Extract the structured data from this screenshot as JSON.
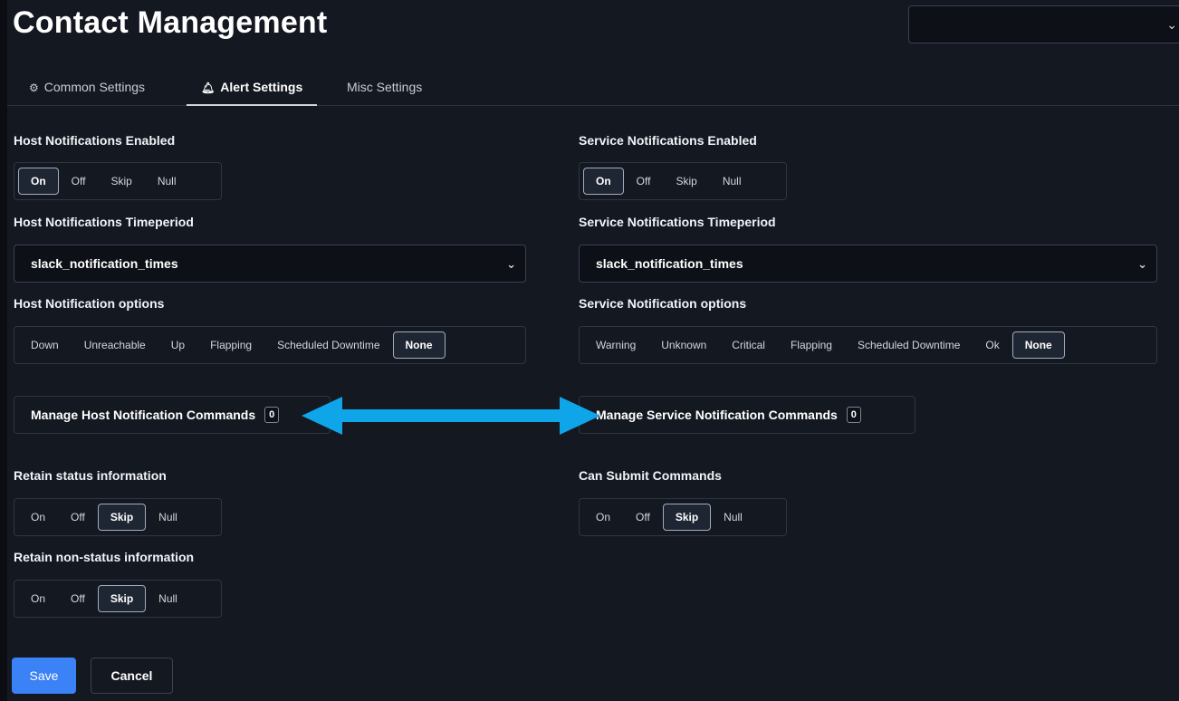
{
  "page": {
    "title": "Contact Management",
    "top_select_value": ""
  },
  "tabs": [
    {
      "label": "Common Settings",
      "icon": "gear-icon"
    },
    {
      "label": "Alert Settings",
      "icon": "bell-icon"
    },
    {
      "label": "Misc Settings",
      "icon": ""
    }
  ],
  "active_tab": "Alert Settings",
  "host_notifications_enabled": {
    "label": "Host Notifications Enabled",
    "options": [
      "On",
      "Off",
      "Skip",
      "Null"
    ],
    "selected": "On"
  },
  "service_notifications_enabled": {
    "label": "Service Notifications Enabled",
    "options": [
      "On",
      "Off",
      "Skip",
      "Null"
    ],
    "selected": "On"
  },
  "host_notifications_timeperiod": {
    "label": "Host Notifications Timeperiod",
    "value": "slack_notification_times"
  },
  "service_notifications_timeperiod": {
    "label": "Service Notifications Timeperiod",
    "value": "slack_notification_times"
  },
  "host_notification_options": {
    "label": "Host Notification options",
    "options": [
      "Down",
      "Unreachable",
      "Up",
      "Flapping",
      "Scheduled Downtime",
      "None"
    ],
    "selected": "None"
  },
  "service_notification_options": {
    "label": "Service Notification options",
    "options": [
      "Warning",
      "Unknown",
      "Critical",
      "Flapping",
      "Scheduled Downtime",
      "Ok",
      "None"
    ],
    "selected": "None"
  },
  "host_commands": {
    "label": "Manage Host Notification Commands",
    "count": "0"
  },
  "service_commands": {
    "label": "Manage Service Notification Commands",
    "count": "0"
  },
  "arrow_color": "#0ea5e9",
  "retain_status": {
    "label": "Retain status information",
    "options": [
      "On",
      "Off",
      "Skip",
      "Null"
    ],
    "selected": "Skip"
  },
  "can_submit_commands": {
    "label": "Can Submit Commands",
    "options": [
      "On",
      "Off",
      "Skip",
      "Null"
    ],
    "selected": "Skip"
  },
  "retain_nonstatus": {
    "label": "Retain non-status information",
    "options": [
      "On",
      "Off",
      "Skip",
      "Null"
    ],
    "selected": "Skip"
  },
  "footer": {
    "save": "Save",
    "cancel": "Cancel"
  }
}
